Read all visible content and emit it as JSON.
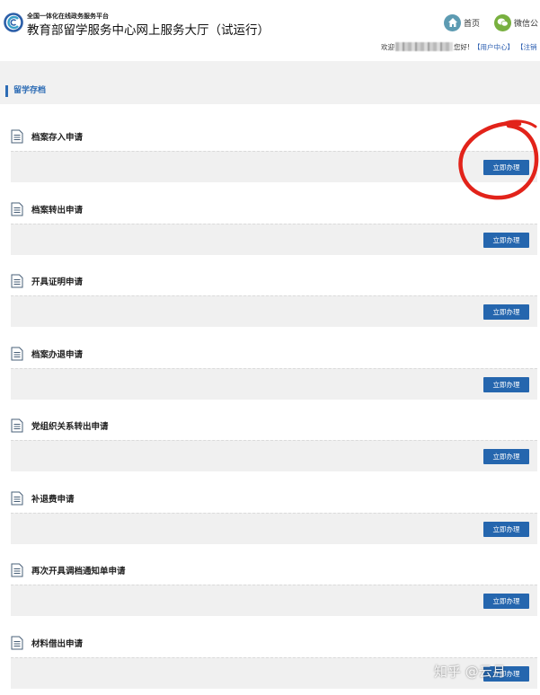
{
  "header": {
    "platform_name": "全国一体化在线政务服务平台",
    "site_title": "教育部留学服务中心网上服务大厅（试运行）",
    "nav_home": "首页",
    "nav_wechat": "微信公",
    "welcome_prefix": "欢迎",
    "welcome_suffix": "您好!",
    "user_center": "【用户中心】",
    "logout": "【注销"
  },
  "section": {
    "title": "留学存档"
  },
  "items": [
    {
      "title": "档案存入申请",
      "button": "立即办理"
    },
    {
      "title": "档案转出申请",
      "button": "立即办理"
    },
    {
      "title": "开具证明申请",
      "button": "立即办理"
    },
    {
      "title": "档案办退申请",
      "button": "立即办理"
    },
    {
      "title": "党组织关系转出申请",
      "button": "立即办理"
    },
    {
      "title": "补退费申请",
      "button": "立即办理"
    },
    {
      "title": "再次开具调档通知单申请",
      "button": "立即办理"
    },
    {
      "title": "材料借出申请",
      "button": "立即办理"
    }
  ],
  "watermark": "知乎 @云月",
  "colors": {
    "accent": "#2566ae",
    "panel": "#f0f0f0",
    "annotation": "#e2231a"
  }
}
